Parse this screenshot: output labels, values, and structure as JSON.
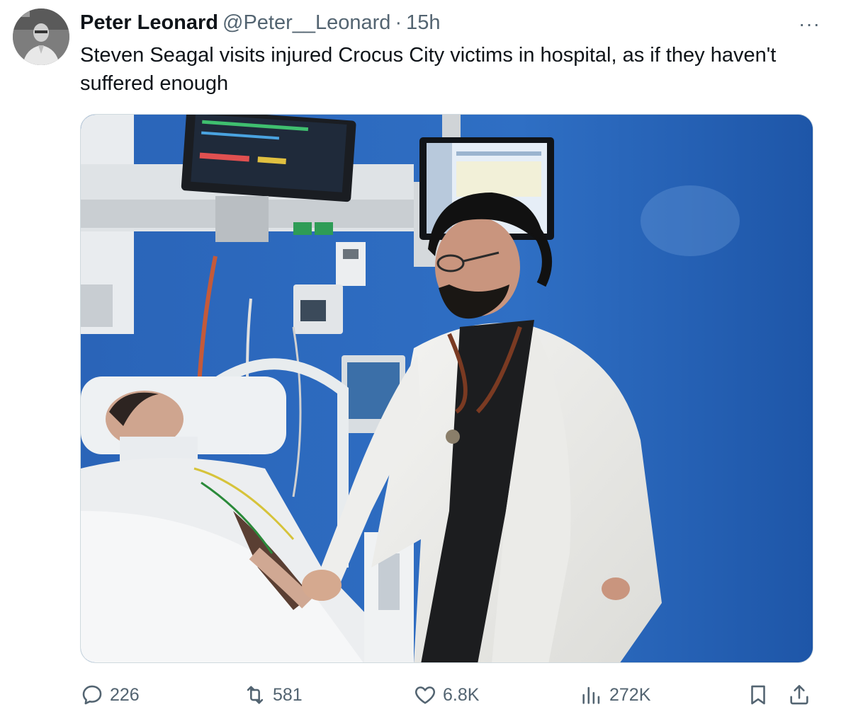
{
  "tweet": {
    "author": {
      "name": "Peter Leonard",
      "handle": "@Peter__Leonard",
      "separator": "·",
      "time": "15h"
    },
    "more_label": "···",
    "text": "Steven Seagal visits injured Crocus City victims in hospital, as if they haven't suffered enough",
    "media": {
      "kind": "photo"
    },
    "actions": {
      "replies": "226",
      "reposts": "581",
      "likes": "6.8K",
      "views": "272K"
    },
    "icons": {
      "reply": "reply-icon",
      "repost": "repost-icon",
      "like": "heart-icon",
      "views": "views-icon",
      "bookmark": "bookmark-icon",
      "share": "share-icon"
    },
    "colors": {
      "text_primary": "#0f1419",
      "text_secondary": "#536471",
      "border": "#cfd9de"
    }
  }
}
